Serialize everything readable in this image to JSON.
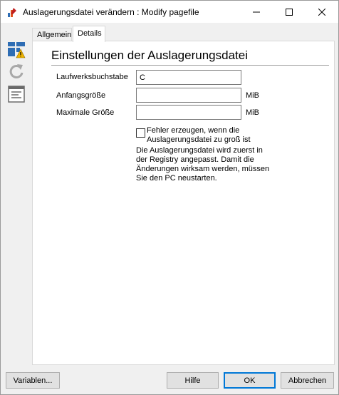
{
  "window": {
    "title": "Auslagerungsdatei verändern : Modify pagefile",
    "icon": "app-icon",
    "controls": {
      "minimize": "minimize-icon",
      "maximize": "maximize-icon",
      "close": "close-icon"
    }
  },
  "sidebar": {
    "items": [
      {
        "icon": "layout-warning-icon"
      },
      {
        "icon": "refresh-icon"
      },
      {
        "icon": "document-list-icon"
      }
    ]
  },
  "tabs": [
    {
      "label": "Allgemein",
      "active": false
    },
    {
      "label": "Details",
      "active": true
    }
  ],
  "details": {
    "heading": "Einstellungen der Auslagerungsdatei",
    "fields": {
      "drive": {
        "label": "Laufwerksbuchstabe",
        "value": "C"
      },
      "initial_size": {
        "label": "Anfangsgröße",
        "value": "",
        "unit": "MiB"
      },
      "max_size": {
        "label": "Maximale Größe",
        "value": "",
        "unit": "MiB"
      }
    },
    "error_checkbox": {
      "checked": false,
      "label_line1": "Fehler erzeugen, wenn die",
      "label_line2": "Auslagerungsdatei zu groß ist"
    },
    "info_lines": [
      "Die Auslagerungsdatei wird zuerst in",
      "der Registry angepasst. Damit die",
      "Änderungen wirksam werden, müssen",
      "Sie den PC neustarten."
    ]
  },
  "footer": {
    "variables_label": "Variablen...",
    "help_label": "Hilfe",
    "ok_label": "OK",
    "cancel_label": "Abbrechen"
  },
  "colors": {
    "accent": "#0078d7",
    "warning": "#f0b400",
    "tile_blue": "#2e6db4"
  }
}
